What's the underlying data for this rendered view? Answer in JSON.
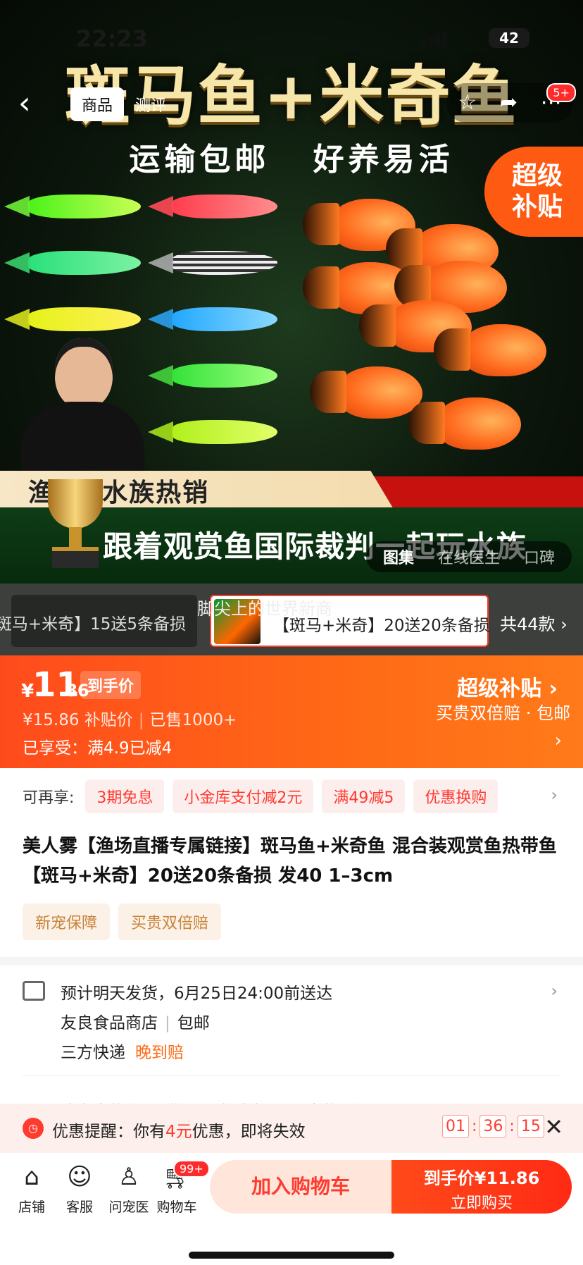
{
  "status": {
    "time": "22:23",
    "battery": "42"
  },
  "nav": {
    "back_icon": "chevron-left-icon",
    "tab_product": "商品",
    "tab_review": "测评",
    "more_badge": "5+"
  },
  "hero": {
    "title": "斑马鱼+米奇鱼",
    "subtitle": "运输包邮 好养易活",
    "super_tag_line1": "超级",
    "super_tag_line2": "补贴",
    "banner_top": "渔 友 水族热销",
    "banner_bottom": "跟着观赏鱼国际裁判一起玩水族",
    "gallery_tabs": [
      "图集",
      "在线医生",
      "口碑"
    ]
  },
  "variants": {
    "caption": "脚尖上的世界新商",
    "chip1": "斑马+米奇】15送5条备损",
    "chip2": "【斑马+米奇】20送20条备损",
    "count": "共44款 ›"
  },
  "price": {
    "yen": "¥",
    "int": "11",
    "dec": ".86",
    "tag": "到手价",
    "original": "¥15.86",
    "subsidy_label": "补贴价",
    "sold": "已售1000+",
    "enjoyed": "已享受：满4.9已减4",
    "super_subsidy": "超级补贴 ›",
    "guarantee": "买贵双倍赔 · 包邮"
  },
  "promos": {
    "label": "可再享:",
    "chips": [
      "3期免息",
      "小金库支付减2元",
      "满49减5",
      "优惠换购"
    ]
  },
  "product": {
    "title": "美人雾【渔场直播专属链接】斑马鱼+米奇鱼 混合装观赏鱼热带鱼 【斑马+米奇】20送20条备损 发40 1–3cm",
    "badges": [
      "新宠保障",
      "买贵双倍赔"
    ]
  },
  "shipping": {
    "line1": "预计明天发货，6月25日24:00前送达",
    "shop": "友良食品商店",
    "free": "包邮",
    "carrier": "三方快递",
    "late": "晚到赔",
    "member": "成为宠物会员 赠10元立减券 30天宠物医保"
  },
  "reminder": {
    "prefix": "优惠提醒：你有",
    "amount": "4元",
    "suffix": "优惠，即将失效",
    "hh": "01",
    "mm": "36",
    "ss": "15"
  },
  "bottom": {
    "store": "店铺",
    "service": "客服",
    "doctor": "问宠医",
    "cart": "购物车",
    "cart_badge": "99+",
    "add_cart": "加入购物车",
    "buy_price": "到手价¥11.86",
    "buy_now": "立即购买"
  }
}
